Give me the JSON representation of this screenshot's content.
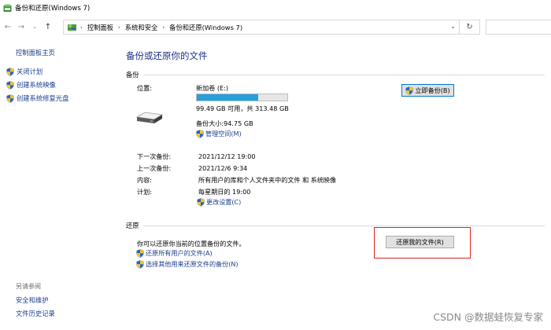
{
  "window": {
    "title": "备份和还原(Windows 7)"
  },
  "nav": {
    "back_icon": "left-arrow-icon",
    "forward_icon": "right-arrow-icon",
    "recent_icon": "chevron-down-icon",
    "up_icon": "up-arrow-icon",
    "breadcrumb": [
      "控制面板",
      "系统和安全",
      "备份和还原(Windows 7)"
    ],
    "refresh_icon": "refresh-icon"
  },
  "sidebar": {
    "home": "控制面板主页",
    "links": [
      "关闭计划",
      "创建系统映像",
      "创建系统修复光盘"
    ],
    "see_also": "另请参阅",
    "see_also_items": [
      "安全和维护",
      "文件历史记录"
    ]
  },
  "main": {
    "title": "备份或还原你的文件",
    "backup": {
      "section": "备份",
      "location_label": "位置:",
      "volume": "新加卷 (E:)",
      "usage_fraction": 0.68,
      "free_text": "99.49 GB 可用，共 313.48 GB",
      "backup_size": "备份大小:94.75 GB",
      "manage_space": "管理空间(M)",
      "backup_now": "立即备份(B)",
      "next_label": "下一次备份:",
      "next_value": "2021/12/12 19:00",
      "last_label": "上一次备份:",
      "last_value": "2021/12/6 9:34",
      "content_label": "内容:",
      "content_value": "所有用户的库和个人文件夹中的文件 和 系统映像",
      "schedule_label": "计划:",
      "schedule_value": "每星期日的 19:00",
      "change_settings": "更改设置(C)"
    },
    "restore": {
      "section": "还原",
      "description": "你可以还原你当前的位置备份的文件。",
      "restore_all": "还原所有用户的文件(A)",
      "select_other": "选择其他用来还原文件的备份(N)",
      "restore_my_files": "还原我的文件(R)"
    }
  },
  "watermark": "CSDN @数据蛙恢复专家",
  "colors": {
    "link": "#1a3e8c",
    "heading": "#1e3287",
    "progress": "#26a0da",
    "highlight": "#e02020"
  }
}
